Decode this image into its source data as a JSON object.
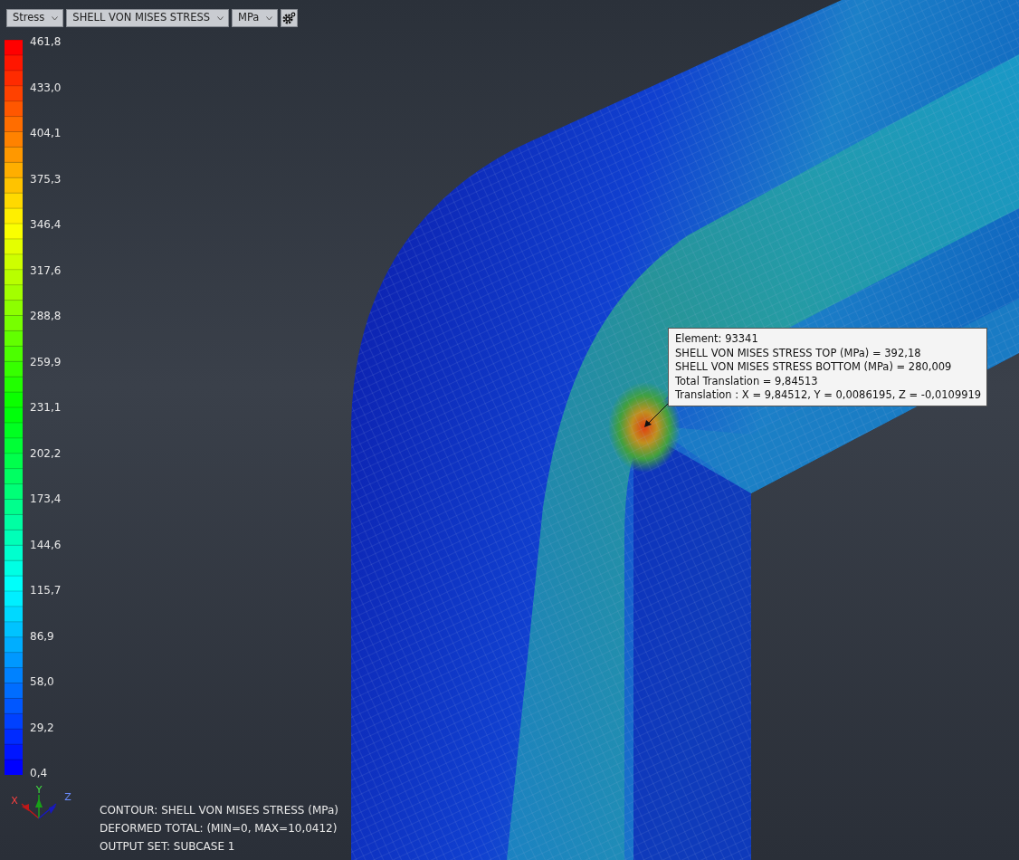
{
  "toolbar": {
    "dropdowns": [
      {
        "label": "Stress"
      },
      {
        "label": "SHELL VON MISES STRESS"
      },
      {
        "label": "MPa"
      }
    ]
  },
  "legend": {
    "labels": [
      "461,8",
      "433,0",
      "404,1",
      "375,3",
      "346,4",
      "317,6",
      "288,8",
      "259,9",
      "231,1",
      "202,2",
      "173,4",
      "144,6",
      "115,7",
      "86,9",
      "58,0",
      "29,2",
      "0,4"
    ]
  },
  "probe": {
    "lines": [
      "Element: 93341",
      "SHELL VON MISES STRESS TOP (MPa)  = 392,18",
      "SHELL VON MISES STRESS BOTTOM (MPa)  = 280,009",
      "Total Translation = 9,84513",
      "Translation : X = 9,84512, Y = 0,0086195, Z = -0,0109919"
    ]
  },
  "axis_triad": {
    "labels": [
      "X",
      "Y",
      "Z"
    ]
  },
  "info": [
    "CONTOUR: SHELL VON MISES STRESS (MPa)",
    "DEFORMED TOTAL: (MIN=0, MAX=10,0412)",
    "OUTPUT SET: SUBCASE 1"
  ]
}
